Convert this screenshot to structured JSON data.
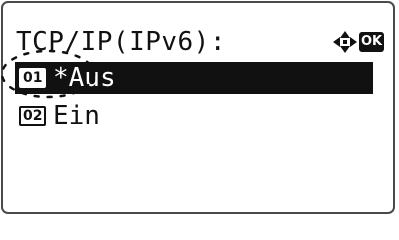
{
  "header": {
    "title": "TCP/IP(IPv6):",
    "nav_icon": "four-way-arrow-icon",
    "ok_label": "OK"
  },
  "options": [
    {
      "number": "01",
      "label": "*Aus",
      "selected": true
    },
    {
      "number": "02",
      "label": " Ein",
      "selected": false
    }
  ],
  "colors": {
    "text": "#111111",
    "selection_background": "#111111",
    "selection_text": "#ffffff",
    "background": "#ffffff"
  }
}
